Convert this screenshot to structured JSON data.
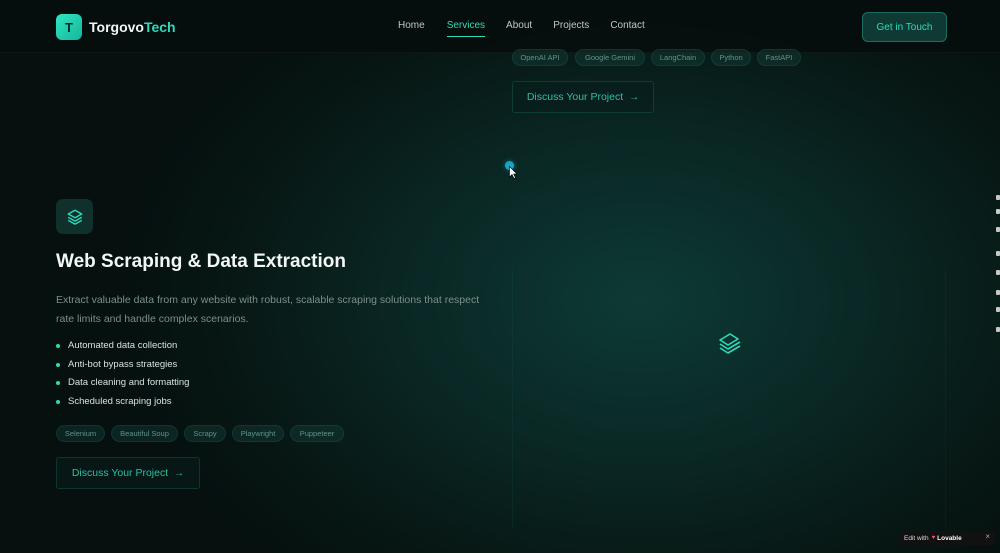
{
  "brand": {
    "initial": "T",
    "name": "Torgovo",
    "accent": "Tech"
  },
  "nav": {
    "links": [
      {
        "label": "Home",
        "active": false
      },
      {
        "label": "Services",
        "active": true
      },
      {
        "label": "About",
        "active": false
      },
      {
        "label": "Projects",
        "active": false
      },
      {
        "label": "Contact",
        "active": false
      }
    ],
    "cta_label": "Get in Touch"
  },
  "previous_service": {
    "tags": [
      "OpenAI API",
      "Google Gemini",
      "LangChain",
      "Python",
      "FastAPI"
    ],
    "button_label": "Discuss Your Project"
  },
  "service": {
    "icon": "layers-icon",
    "title": "Web Scraping & Data Extraction",
    "description": "Extract valuable data from any website with robust, scalable scraping solutions that respect rate limits and handle complex scenarios.",
    "features": [
      "Automated data collection",
      "Anti-bot bypass strategies",
      "Data cleaning and formatting",
      "Scheduled scraping jobs"
    ],
    "tags": [
      "Selenium",
      "Beautiful Soup",
      "Scrapy",
      "Playwright",
      "Puppeteer"
    ],
    "button_label": "Discuss Your Project",
    "visual_icon": "layers-icon"
  },
  "edit_badge": {
    "prefix": "Edit with",
    "brand": "Lovable",
    "close": "×"
  },
  "colors": {
    "accent": "#2fd9bb",
    "background": "#071714",
    "nav_background": "#060e0d"
  }
}
